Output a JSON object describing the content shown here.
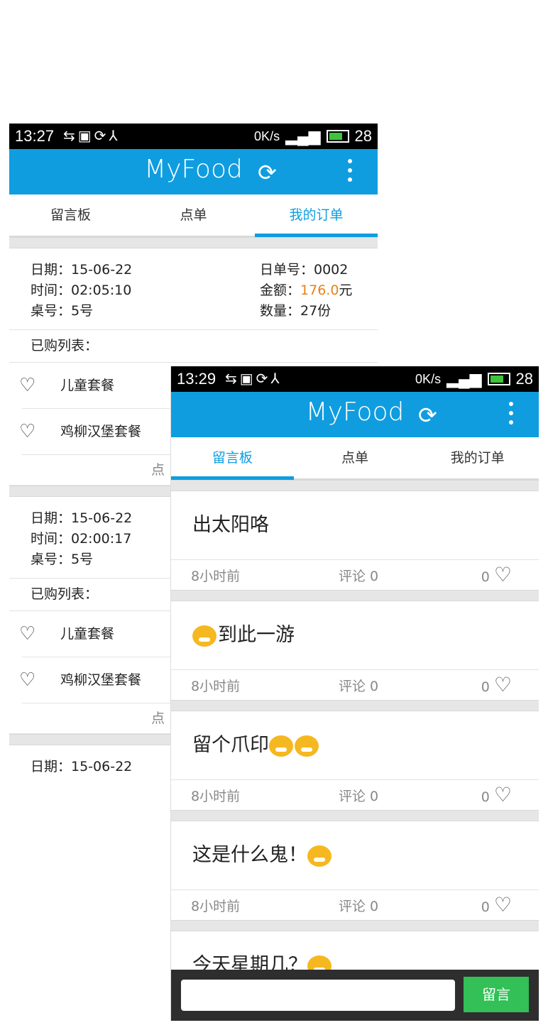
{
  "screen1": {
    "status": {
      "time": "13:27",
      "left_icons": "⇆▣⟳⅄",
      "kbs": "0K/s",
      "signal": "▂▄▆",
      "battery": "28"
    },
    "appbar": {
      "title": "MyFood",
      "refresh_icon": "⟳"
    },
    "tabs": [
      {
        "label": "留言板"
      },
      {
        "label": "点单"
      },
      {
        "label": "我的订单"
      }
    ],
    "orders": [
      {
        "date": "日期：15-06-22",
        "time": "时间：02:05:10",
        "table": "桌号：5号",
        "order_no": "日单号：0002",
        "amount_label": "金额：",
        "amount_value": "176.0",
        "amount_unit": "元",
        "qty": "数量：27份",
        "list_label": "已购列表：",
        "items": [
          {
            "name": "儿童套餐"
          },
          {
            "name": "鸡柳汉堡套餐"
          }
        ],
        "footer": "点"
      },
      {
        "date": "日期：15-06-22",
        "time": "时间：02:00:17",
        "table": "桌号：5号",
        "list_label": "已购列表：",
        "items": [
          {
            "name": "儿童套餐"
          },
          {
            "name": "鸡柳汉堡套餐"
          }
        ],
        "footer": "点"
      },
      {
        "date": "日期：15-06-22"
      }
    ]
  },
  "screen2": {
    "status": {
      "time": "13:29",
      "left_icons": "⇆▣⟳⅄",
      "kbs": "0K/s",
      "signal": "▂▄▆",
      "battery": "28"
    },
    "appbar": {
      "title": "MyFood",
      "refresh_icon": "⟳"
    },
    "tabs": [
      {
        "label": "留言板"
      },
      {
        "label": "点单"
      },
      {
        "label": "我的订单"
      }
    ],
    "posts": [
      {
        "text": "出太阳咯",
        "ago": "8小时前",
        "comments": "评论 0",
        "likes": "0"
      },
      {
        "text": "到此一游",
        "ago": "8小时前",
        "comments": "评论 0",
        "likes": "0"
      },
      {
        "text": "留个爪印",
        "ago": "8小时前",
        "comments": "评论 0",
        "likes": "0"
      },
      {
        "text": "这是什么鬼！",
        "ago": "8小时前",
        "comments": "评论 0",
        "likes": "0"
      },
      {
        "text": "今天星期几？"
      }
    ],
    "input": {
      "placeholder": "",
      "send_label": "留言"
    }
  },
  "colors": {
    "primary": "#0f9de0",
    "amount": "#e8811a",
    "send": "#32c057"
  }
}
